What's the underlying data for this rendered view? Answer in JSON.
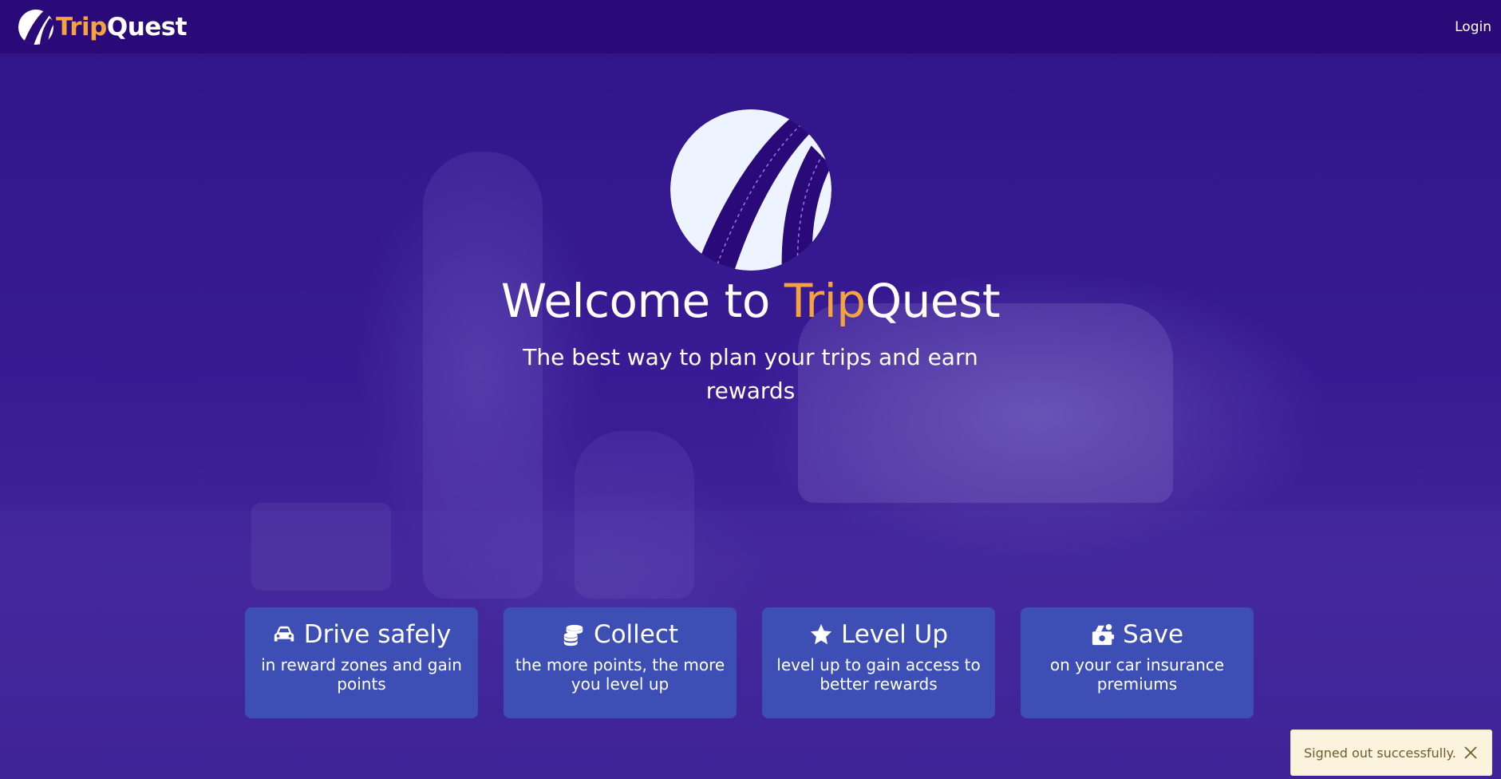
{
  "header": {
    "brand_trip": "Trip",
    "brand_quest": "Quest",
    "logo_icon": "tripquest-road-logo-icon",
    "login_label": "Login"
  },
  "hero": {
    "title_prefix": "Welcome to ",
    "title_accent": "Trip",
    "title_suffix": "Quest",
    "subtitle": "The best way to plan your trips and earn rewards",
    "logo_icon": "tripquest-road-logo-icon"
  },
  "cards": [
    {
      "icon": "car-icon",
      "title": "Drive safely",
      "description": "in reward zones and gain points"
    },
    {
      "icon": "coins-icon",
      "title": "Collect",
      "description": "the more points, the more you level up"
    },
    {
      "icon": "star-icon",
      "title": "Level Up",
      "description": "level up to gain access to better rewards"
    },
    {
      "icon": "piggy-bank-icon",
      "title": "Save",
      "description": "on your car insurance premiums"
    }
  ],
  "toast": {
    "message": "Signed out successfully.",
    "close_icon": "close-icon"
  },
  "colors": {
    "header_bg": "#2a0a78",
    "hero_bg": "#33128c",
    "accent_orange": "#f5a340",
    "card_bg": "#3d4fb4",
    "toast_bg": "#fbf3dd",
    "toast_text": "#6d5d2e"
  }
}
